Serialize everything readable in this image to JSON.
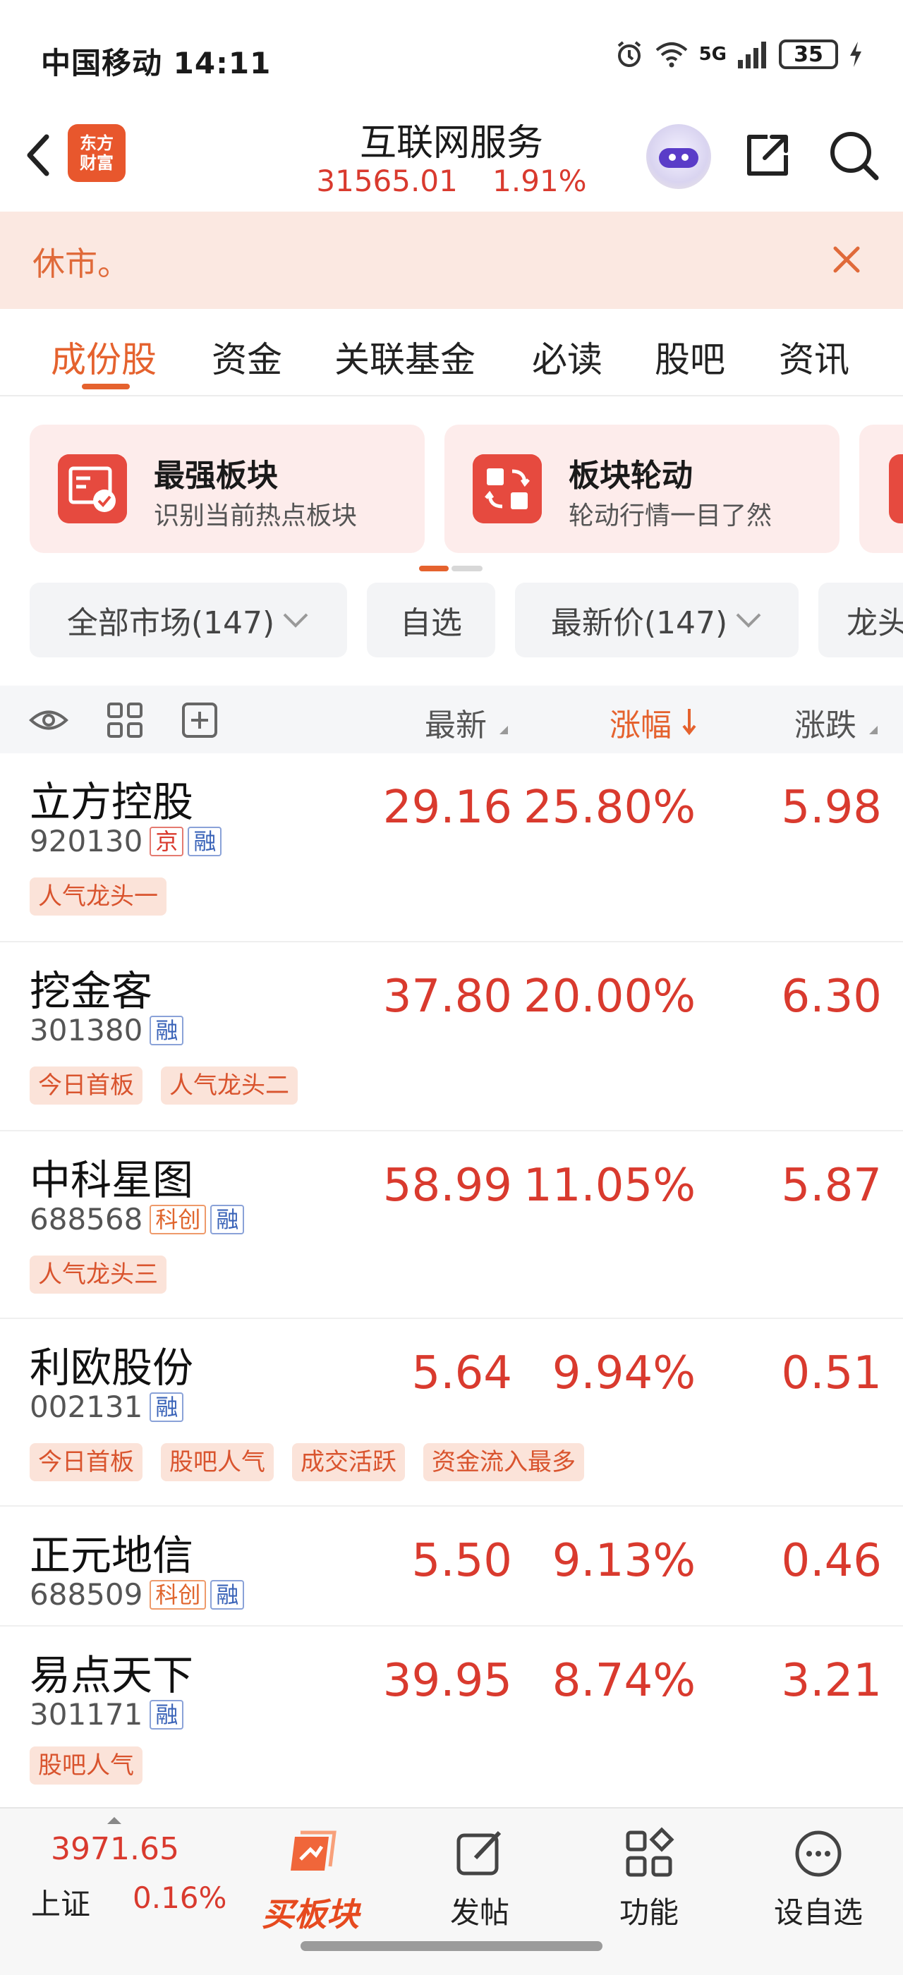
{
  "status": {
    "carrier_time": "中国移动 14:11",
    "network": "5G",
    "battery": "35"
  },
  "header": {
    "logo_line1": "东方",
    "logo_line2": "财富",
    "title": "互联网服务",
    "index_value": "31565.01",
    "index_change": "1.91%"
  },
  "notice": {
    "text": "休市。"
  },
  "tabs": [
    "成份股",
    "资金",
    "关联基金",
    "必读",
    "股吧",
    "资讯"
  ],
  "cards": [
    {
      "title": "最强板块",
      "subtitle": "识别当前热点板块"
    },
    {
      "title": "板块轮动",
      "subtitle": "轮动行情一目了然"
    }
  ],
  "filters": {
    "market": "全部市场(147)",
    "watchlist": "自选",
    "sort": "最新价(147)",
    "leader": "龙头"
  },
  "columns": {
    "latest": "最新",
    "change_pct": "涨幅",
    "change": "涨跌"
  },
  "stocks": [
    {
      "name": "立方控股",
      "code": "920130",
      "markers": [
        {
          "text": "京",
          "style": "red"
        },
        {
          "text": "融",
          "style": "blue"
        }
      ],
      "price": "29.16",
      "pct": "25.80%",
      "change": "5.98",
      "tags": [
        "人气龙头一"
      ]
    },
    {
      "name": "挖金客",
      "code": "301380",
      "markers": [
        {
          "text": "融",
          "style": "blue"
        }
      ],
      "price": "37.80",
      "pct": "20.00%",
      "change": "6.30",
      "tags": [
        "今日首板",
        "人气龙头二"
      ]
    },
    {
      "name": "中科星图",
      "code": "688568",
      "markers": [
        {
          "text": "科创",
          "style": "orange"
        },
        {
          "text": "融",
          "style": "blue"
        }
      ],
      "price": "58.99",
      "pct": "11.05%",
      "change": "5.87",
      "tags": [
        "人气龙头三"
      ]
    },
    {
      "name": "利欧股份",
      "code": "002131",
      "markers": [
        {
          "text": "融",
          "style": "blue"
        }
      ],
      "price": "5.64",
      "pct": "9.94%",
      "change": "0.51",
      "tags": [
        "今日首板",
        "股吧人气",
        "成交活跃",
        "资金流入最多"
      ]
    },
    {
      "name": "正元地信",
      "code": "688509",
      "markers": [
        {
          "text": "科创",
          "style": "orange"
        },
        {
          "text": "融",
          "style": "blue"
        }
      ],
      "price": "5.50",
      "pct": "9.13%",
      "change": "0.46",
      "tags": []
    },
    {
      "name": "易点天下",
      "code": "301171",
      "markers": [
        {
          "text": "融",
          "style": "blue"
        }
      ],
      "price": "39.95",
      "pct": "8.74%",
      "change": "3.21",
      "tags": [
        "股吧人气"
      ]
    }
  ],
  "bottom": {
    "index_value": "3971.65",
    "index_name": "上证",
    "index_pct": "0.16%",
    "buy_label": "买板块",
    "post_label": "发帖",
    "func_label": "功能",
    "watch_label": "设自选"
  },
  "colors": {
    "accent": "#e5622e",
    "up": "#d93a2e"
  },
  "icons": [
    "back-icon",
    "eye-icon",
    "grid-icon",
    "add-square-icon",
    "share-icon",
    "search-icon",
    "close-icon"
  ]
}
